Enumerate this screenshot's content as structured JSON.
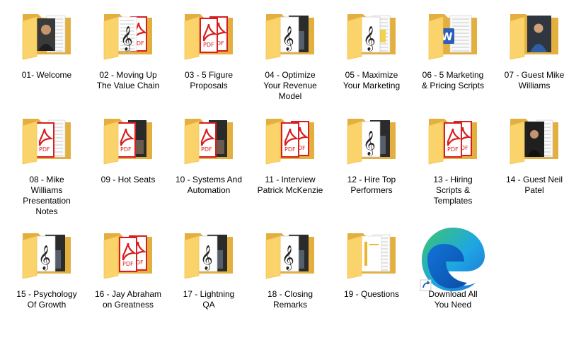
{
  "colors": {
    "folder_back": "#e3b03f",
    "folder_front": "#fbd36b",
    "folder_front_edge": "#f2c457",
    "pdf_red": "#d81e20",
    "edge_blue": "#1d6fd3",
    "edge_green": "#3ec66c",
    "word_blue": "#2b5fb8"
  },
  "items": [
    {
      "label": "01- Welcome",
      "icon": "folder-photo-person-icon",
      "preview": "person"
    },
    {
      "label": "02 - Moving Up\nThe Value Chain",
      "icon": "folder-audio-pdf-icon",
      "preview": "audio-pdf"
    },
    {
      "label": "03 - 5 Figure\nProposals",
      "icon": "folder-pdf-icon",
      "preview": "pdf"
    },
    {
      "label": "04 - Optimize\nYour Revenue\nModel",
      "icon": "folder-audio-video-icon",
      "preview": "audio-video"
    },
    {
      "label": "05 - Maximize\nYour Marketing",
      "icon": "folder-audio-doc-icon",
      "preview": "audio-doc"
    },
    {
      "label": "06 - 5 Marketing\n& Pricing Scripts",
      "icon": "folder-word-doc-icon",
      "preview": "word"
    },
    {
      "label": "07 - Guest Mike\nWilliams",
      "icon": "folder-photo-person-icon",
      "preview": "person-blue"
    },
    {
      "label": "08 - Mike\nWilliams\nPresentation\nNotes",
      "icon": "folder-pdf-doc-icon",
      "preview": "pdf-doc"
    },
    {
      "label": "09 - Hot Seats",
      "icon": "folder-pdf-video-icon",
      "preview": "pdf-video"
    },
    {
      "label": "10 - Systems And\nAutomation",
      "icon": "folder-pdf-video-icon",
      "preview": "pdf-video"
    },
    {
      "label": "11 - Interview\nPatrick McKenzie",
      "icon": "folder-pdf-icon",
      "preview": "pdf"
    },
    {
      "label": "12 - Hire Top\nPerformers",
      "icon": "folder-audio-video-icon",
      "preview": "audio-video"
    },
    {
      "label": "13 - Hiring\nScripts &\nTemplates",
      "icon": "folder-pdf-icon",
      "preview": "pdf"
    },
    {
      "label": "14 - Guest Neil\nPatel",
      "icon": "folder-photo-person-icon",
      "preview": "person-dark"
    },
    {
      "label": "15 - Psychology\nOf Growth",
      "icon": "folder-audio-video-icon",
      "preview": "audio-video"
    },
    {
      "label": "16 - Jay Abraham\non Greatness",
      "icon": "folder-pdf-icon",
      "preview": "pdf"
    },
    {
      "label": "17 - Lightning\nQA",
      "icon": "folder-audio-video-icon",
      "preview": "audio-video"
    },
    {
      "label": "18 - Closing\nRemarks",
      "icon": "folder-audio-video-icon",
      "preview": "audio-video"
    },
    {
      "label": "19 - Questions",
      "icon": "folder-doc-icon",
      "preview": "doc-yellow"
    },
    {
      "label": "Download All\nYou Need",
      "icon": "edge-shortcut-icon",
      "preview": "edge"
    }
  ]
}
